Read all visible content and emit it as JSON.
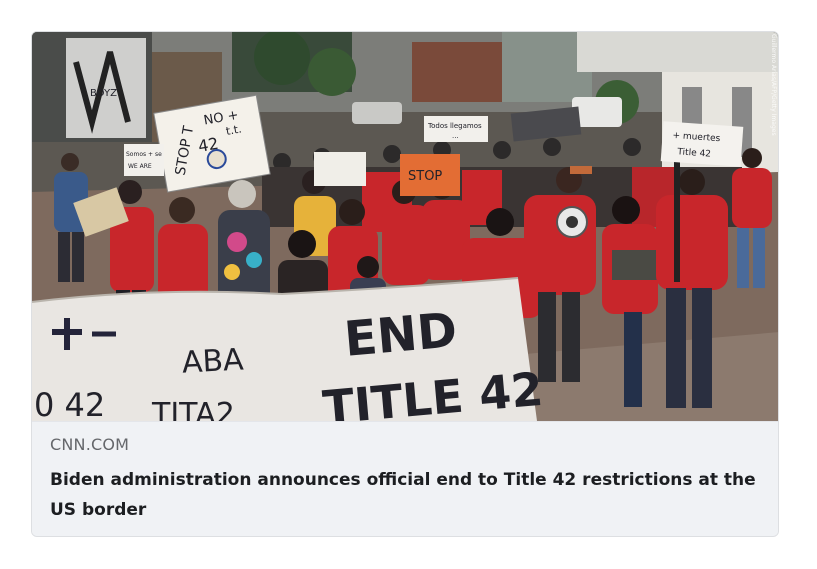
{
  "link_preview": {
    "domain": "CNN.COM",
    "headline": "Biden administration announces official end to Title 42 restrictions at the US border",
    "photo_credit": "Guillermo Arias/AFP/Getty Images"
  },
  "photo": {
    "banner_line1": "END",
    "banner_line2": "TITLE 42",
    "banner_left1": "ABA",
    "banner_left2": "0 42",
    "banner_left3": "TITA2",
    "sign_stop_1": "NO +",
    "sign_stop_2": "t.t.",
    "sign_stop_3": "STOP T",
    "sign_stop_4": "42",
    "sign_small_left": "Somos + se",
    "sign_small_left2": "WE ARE",
    "sign_center": "Todos llegamos ",
    "sign_center2": "...",
    "sign_orange": "STOP",
    "sign_right": "+ muertes",
    "sign_right2": "Title 42",
    "graffiti": "BOYZ"
  },
  "colors": {
    "card_bg": "#f0f2f5",
    "card_border": "#dddfe2",
    "domain_text": "#65676b",
    "headline_text": "#1c1e21",
    "shirt_red": "#c8262b",
    "banner_red": "#b82a2e",
    "banner_white": "#e9e6e2"
  }
}
